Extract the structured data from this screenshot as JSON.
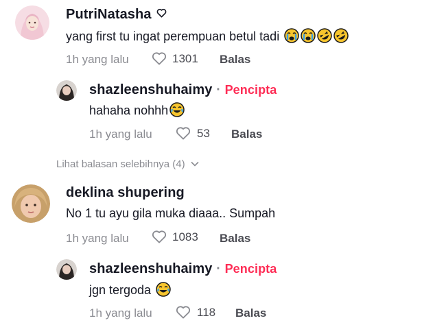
{
  "comments": [
    {
      "author": "PutriNatasha",
      "verified_icon": "heart-outline-icon",
      "text": "yang first tu ingat perempuan betul tadi",
      "emojis": [
        "crying-face",
        "crying-face",
        "rofl-face",
        "rofl-face"
      ],
      "time": "1h yang lalu",
      "likes": "1301",
      "reply_label": "Balas"
    },
    {
      "author": "deklina shupering",
      "text": "No 1 tu ayu gila muka diaaa.. Sumpah",
      "time": "1h yang lalu",
      "likes": "1083",
      "reply_label": "Balas"
    }
  ],
  "replies": [
    {
      "author": "shazleenshuhaimy",
      "separator": "·",
      "badge": "Pencipta",
      "text": "hahaha nohhh",
      "emojis": [
        "joy-face"
      ],
      "time": "1h yang lalu",
      "likes": "53",
      "reply_label": "Balas"
    },
    {
      "author": "shazleenshuhaimy",
      "separator": "·",
      "badge": "Pencipta",
      "text": "jgn tergoda",
      "emojis": [
        "joy-face"
      ],
      "time": "1h yang lalu",
      "likes": "118",
      "reply_label": "Balas"
    }
  ],
  "view_more": "Lihat balasan selebihnya (4)",
  "colors": {
    "creator": "#fe2c55",
    "meta": "#8a8b91"
  }
}
